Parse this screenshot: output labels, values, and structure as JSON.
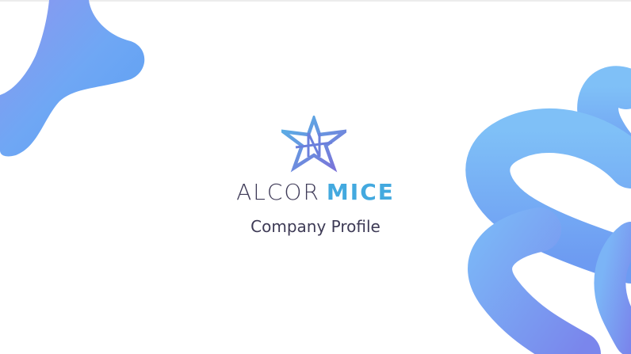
{
  "brand": {
    "word1": "ALCOR",
    "word2": "MICE"
  },
  "subtitle": "Company Profile",
  "colors": {
    "brand_dark": "#3f3b58",
    "brand_accent": "#43a9df",
    "shape_light": "#79b8f5",
    "shape_mid": "#6e8ff0",
    "shape_purple": "#7f86ea"
  },
  "icons": {
    "logo": "star-monogram-logo"
  }
}
